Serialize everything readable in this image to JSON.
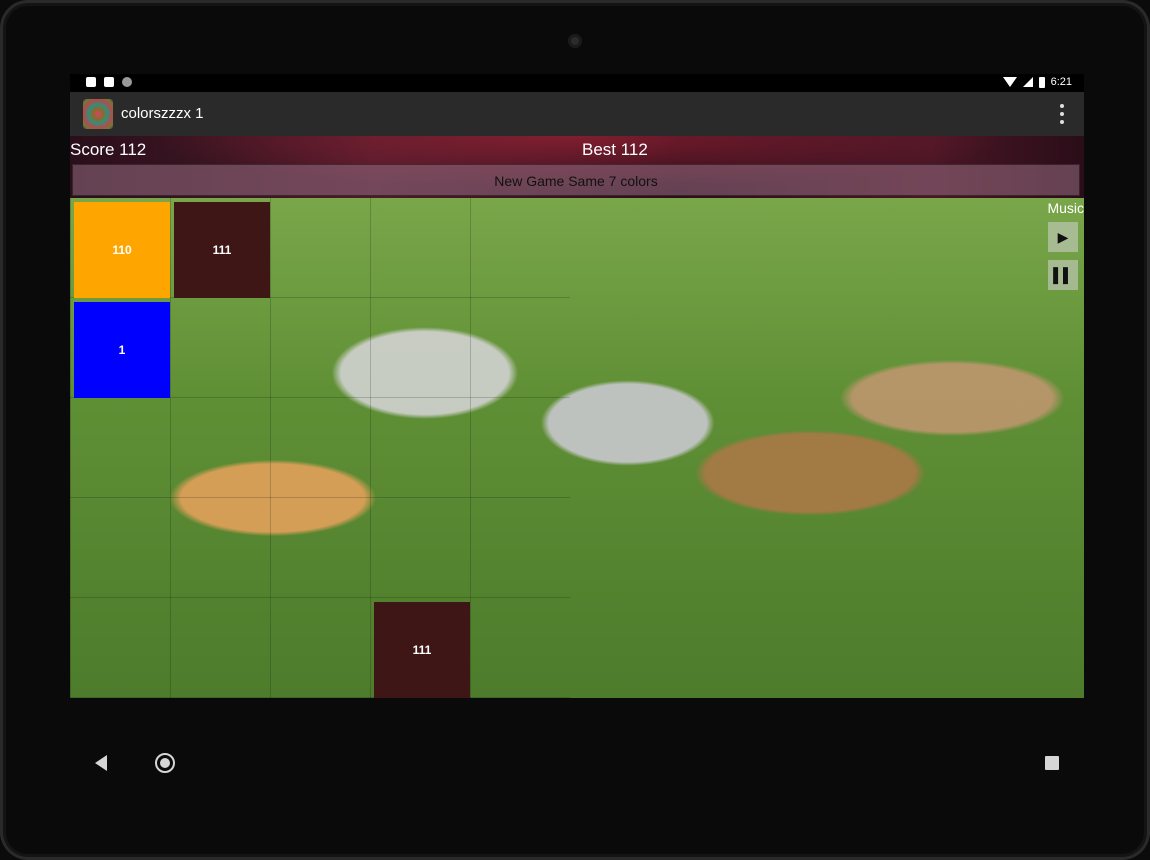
{
  "status_bar": {
    "time": "6:21"
  },
  "app_bar": {
    "title": "colorszzzx 1",
    "menu_icon": "overflow-menu-icon"
  },
  "header": {
    "score_label": "Score 112",
    "best_label": "Best 112",
    "new_game_label": "New Game Same 7 colors"
  },
  "music": {
    "label": "Music",
    "play_icon": "▶",
    "pause_icon": "▌▌"
  },
  "tiles": [
    {
      "value": "110",
      "row": 0,
      "col": 0,
      "color": "#FFA500"
    },
    {
      "value": "111",
      "row": 0,
      "col": 1,
      "color": "#3E1616"
    },
    {
      "value": "1",
      "row": 1,
      "col": 0,
      "color": "#0000FF"
    },
    {
      "value": "111",
      "row": 4,
      "col": 3,
      "color": "#3E1616"
    }
  ],
  "colors": {
    "app_bar": "#2A2A2A",
    "board_accent_grass": "#5F8F35"
  }
}
